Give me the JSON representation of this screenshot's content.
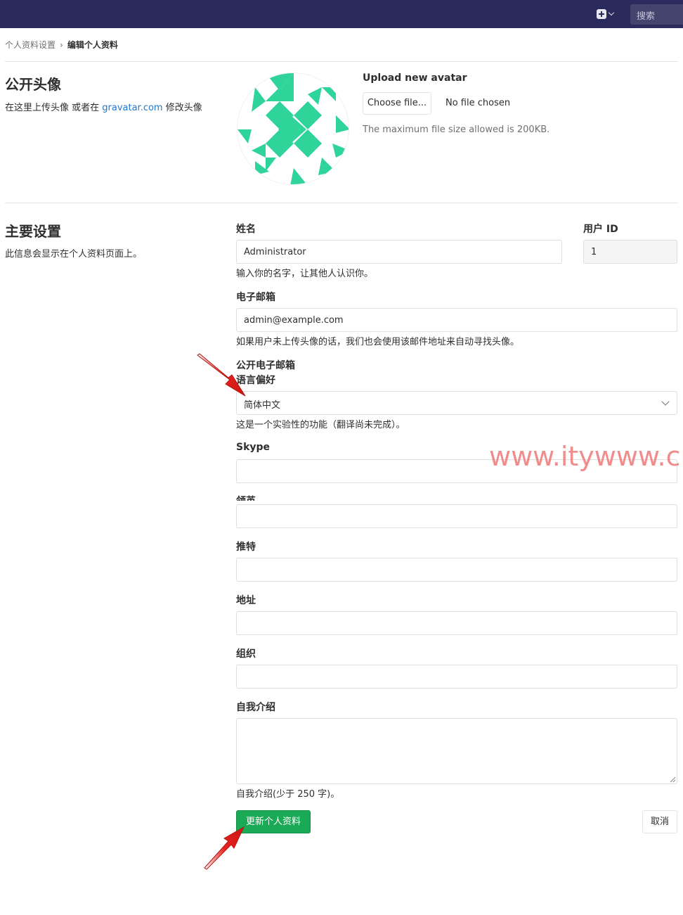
{
  "topbar": {
    "search_placeholder": "搜索",
    "plus_icon": "plus-square-icon",
    "background": "#2b2a5c"
  },
  "breadcrumb": {
    "parent": "个人资料设置",
    "separator": "›",
    "current": "编辑个人资料"
  },
  "avatar_section": {
    "title": "公开头像",
    "desc_prefix": "在这里上传头像 或者在 ",
    "desc_link": "gravatar.com",
    "desc_suffix": " 修改头像",
    "upload_title": "Upload new avatar",
    "choose_label": "Choose file...",
    "no_file_label": "No file chosen",
    "hint": "The maximum file size allowed is 200KB.",
    "identicon_color": "#2fd49b"
  },
  "main_section": {
    "title": "主要设置",
    "desc": "此信息会显示在个人资料页面上。"
  },
  "form": {
    "name_label": "姓名",
    "name_value": "Administrator",
    "name_help": "输入你的名字，让其他人认识你。",
    "user_id_label": "用户 ID",
    "user_id_value": "1",
    "email_label": "电子邮箱",
    "email_value": "admin@example.com",
    "email_help": "如果用户未上传头像的话，我们也会使用该邮件地址来自动寻找头像。",
    "public_email_label": "公开电子邮箱",
    "language_label": "语言偏好",
    "language_value": "简体中文",
    "language_help": "这是一个实验性的功能（翻译尚未完成）。",
    "skype_label": "Skype",
    "linkedin_label": "领英",
    "twitter_label": "推特",
    "location_label": "地址",
    "organization_label": "组织",
    "bio_label": "自我介绍",
    "bio_help": "自我介绍(少于 250 字)。",
    "submit_label": "更新个人资料",
    "cancel_label": "取消"
  },
  "watermark": "www.itywww.cn",
  "colors": {
    "primary_button": "#1aaa55",
    "link": "#1f78d1",
    "annotation_arrow": "#e8231f"
  }
}
